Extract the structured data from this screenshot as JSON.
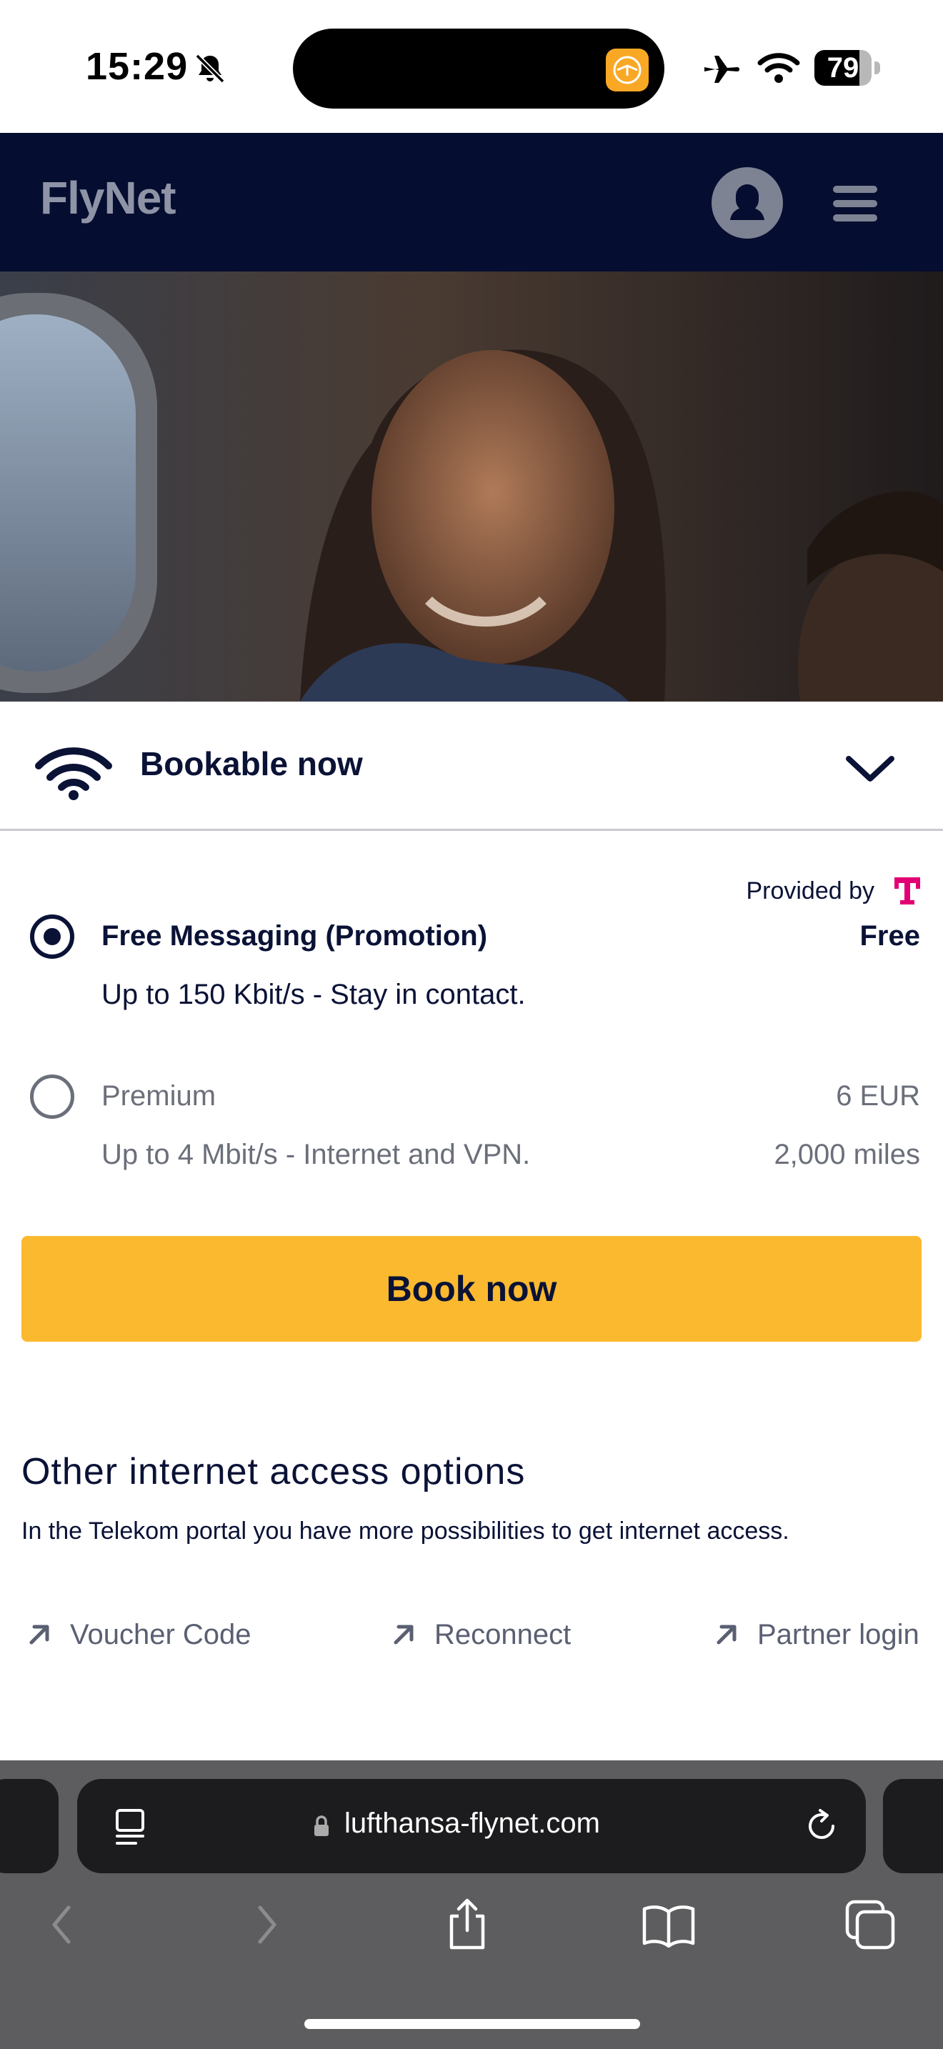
{
  "status_bar": {
    "time": "15:29",
    "battery": "79",
    "battery_level": 0.79,
    "icons": [
      "bell-slash-icon",
      "lufthansa-app-icon",
      "airplane-icon",
      "wifi-icon",
      "battery-icon"
    ]
  },
  "header": {
    "logo": "FlyNet",
    "icons": [
      "account-icon",
      "menu-icon"
    ]
  },
  "booking": {
    "title": "Bookable now",
    "provided_by": "Provided by",
    "options": [
      {
        "name": "Free Messaging (Promotion)",
        "description": "Up to 150 Kbit/s - Stay in contact.",
        "price": "Free",
        "selected": true
      },
      {
        "name": "Premium",
        "description": "Up to 4 Mbit/s - Internet and VPN.",
        "price": "6 EUR",
        "miles": "2,000 miles",
        "selected": false
      }
    ],
    "book_button": "Book now"
  },
  "other": {
    "title": "Other internet access options",
    "description": "In the Telekom portal you have more possibilities to get internet access.",
    "links": [
      "Voucher Code",
      "Reconnect",
      "Partner login"
    ]
  },
  "browser": {
    "url": "lufthansa-flynet.com",
    "icons": [
      "reader-icon",
      "lock-icon",
      "reload-icon",
      "back-icon",
      "forward-icon",
      "share-icon",
      "bookmarks-icon",
      "tabs-icon"
    ]
  },
  "colors": {
    "navy": "#050d30",
    "accent_yellow": "#fbb92f",
    "telekom_magenta": "#e20074",
    "text_dark": "#0a1236",
    "text_muted": "#6b6f7a"
  }
}
